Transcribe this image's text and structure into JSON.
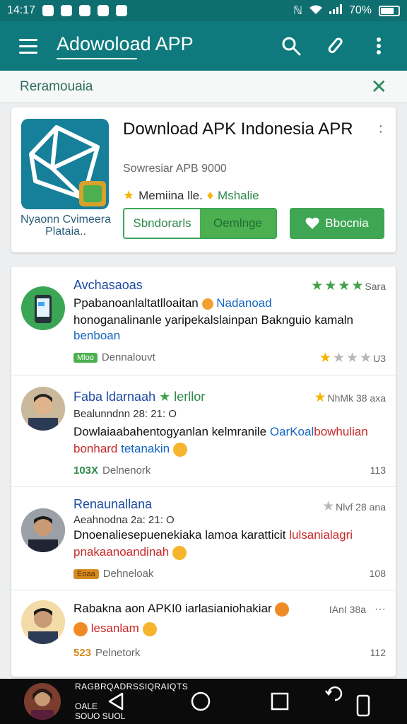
{
  "status_bar": {
    "time": "14:17",
    "battery": "70%"
  },
  "app_bar": {
    "title": "Adowoload APP"
  },
  "sub_bar": {
    "label": "Reramouaia",
    "close_glyph": "✕"
  },
  "app_card": {
    "name": "Download APK Indonesia APR",
    "developer": "Nyaonn Cvimeera Plataia..",
    "subtitle": "Sowresiar APB 9000",
    "rating_text": "Memiina  lle.",
    "rating_text2": "Mshalie",
    "segment_left": "Sbndorarls",
    "segment_right": "Oemlnge",
    "primary_button": "Bbocnia"
  },
  "reviews": [
    {
      "name": "Avchasaoas",
      "rating_text": "Sara",
      "line1_a": "Ppabanoanlaltatlloaitan",
      "line1_b": "Nadanoad",
      "line2": "honoganalinanle yaripekalslainpan Baknguio kamaln",
      "line3": "benboan",
      "meta_tag": "Mloo",
      "meta_text": "Dennalouvt",
      "count": "U3"
    },
    {
      "name": "Faba ldarnaah",
      "name_suffix": "lerllor",
      "rating_text": "NhMk 38 axa",
      "date": "Bealunndnn 28: 21:  O",
      "line1_a": "Dowlaiaabahentogyanlan kelmranile",
      "line1_b": "OarKoal",
      "line1_c": "bowhulian",
      "line2_a": "bonhard",
      "line2_b": "tetanakin",
      "meta_tag": "103X",
      "meta_text": "Delnenork",
      "count": "113"
    },
    {
      "name": "Renaunallana",
      "rating_text": "Nlvf 28 ana",
      "date": "Aeahnodna 2a: 21:  O",
      "line1_a": "Dnoenaliesepuenekiaka  lamoa karatticit",
      "line1_b": "lulsanialagri",
      "line2": "pnakaanoandinah",
      "meta_tag": "Eoaa",
      "meta_text": "Dehneloak",
      "count": "108"
    },
    {
      "name": "Rabakna aon APKI0 iarlasianiohakiar",
      "rating_text": "IAnI 38a",
      "line2": "lesanlam",
      "meta_tag": "523",
      "meta_text": "Pelnetork",
      "count": "112"
    }
  ],
  "nav_bar": {
    "text1": "RAGBRQADRSSIQRAIQTS",
    "text2a": "OALE",
    "text2b": "SOUO SUOL"
  }
}
